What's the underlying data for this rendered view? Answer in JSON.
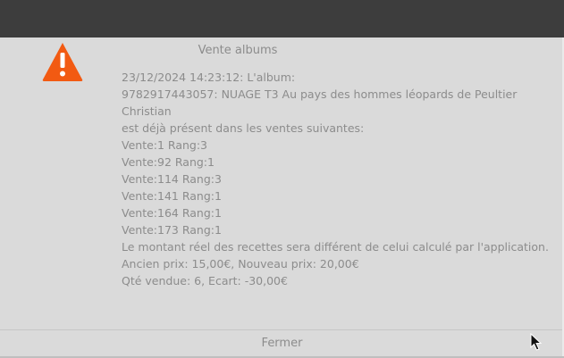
{
  "dialog": {
    "title": "Vente albums",
    "icon": "warning-icon",
    "icon_color": "#f25a12",
    "lines": [
      "23/12/2024 14:23:12: L'album:",
      "9782917443057: NUAGE T3 Au pays des hommes léopards de Peultier",
      "Christian",
      "est déjà présent dans les ventes suivantes:",
      "Vente:1 Rang:3",
      "Vente:92 Rang:1",
      "Vente:114 Rang:3",
      "Vente:141 Rang:1",
      "Vente:164 Rang:1",
      "Vente:173 Rang:1",
      "Le montant réel des recettes sera différent de celui calculé par l'application.",
      "Ancien prix: 15,00€, Nouveau prix: 20,00€",
      "Qté vendue: 6, Ecart: -30,00€"
    ],
    "close_label": "Fermer"
  },
  "colors": {
    "titlebar": "#3d3d3d",
    "background": "#dadada",
    "text": "#8c8c8c"
  }
}
